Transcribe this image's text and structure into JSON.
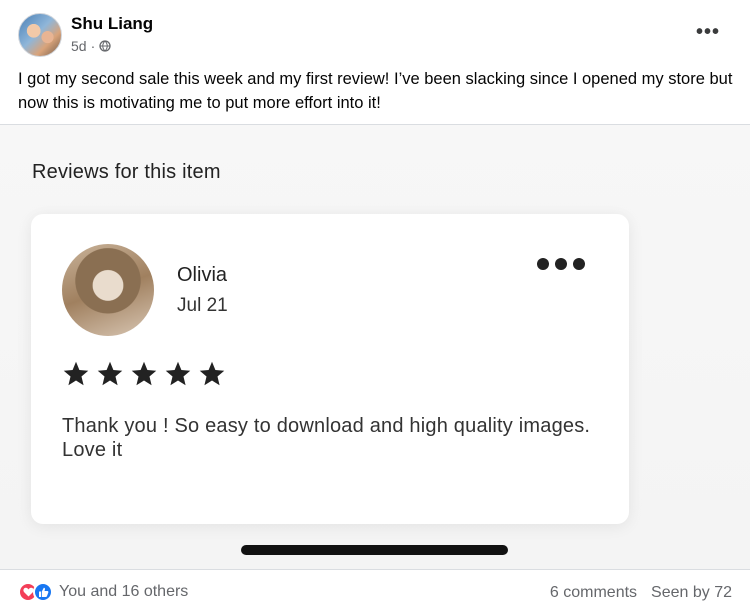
{
  "post": {
    "author": "Shu Liang",
    "time": "5d",
    "privacy_icon": "globe-icon",
    "text": "I got my second sale this week and my first review! I’ve been slacking since I opened my store but now this is motivating me to put more effort into it!"
  },
  "review_image": {
    "heading": "Reviews for this item",
    "reviewer": "Olivia",
    "date": "Jul 21",
    "rating": 5,
    "rating_max": 5,
    "review_text": "Thank you ! So easy to download and high quality images. Love it"
  },
  "footer": {
    "reactions_text": "You and 16 others",
    "comments": "6 comments",
    "seen": "Seen by 72"
  },
  "colors": {
    "love": "#f33e58",
    "like": "#1877f2",
    "secondary_text": "#65676b"
  }
}
